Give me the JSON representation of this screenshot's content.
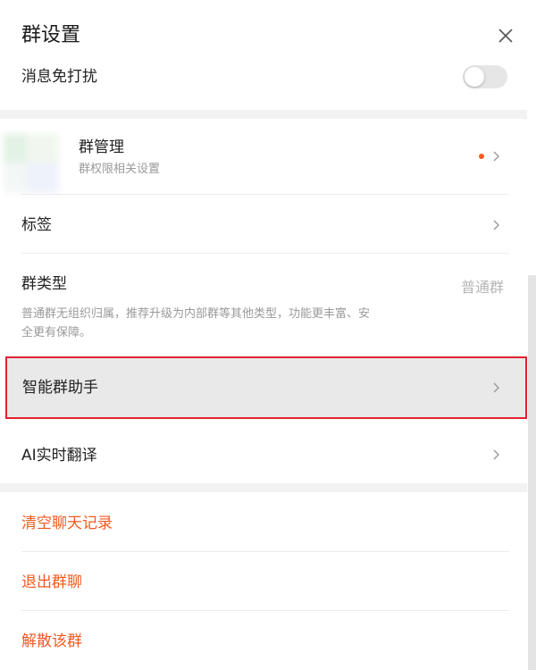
{
  "header": {
    "title": "群设置",
    "close_icon": "close-icon"
  },
  "settings": {
    "mute": {
      "label": "消息免打扰",
      "enabled": false
    },
    "group_manage": {
      "title": "群管理",
      "subtitle": "群权限相关设置",
      "has_badge": true
    },
    "tags": {
      "label": "标签"
    },
    "group_type": {
      "label": "群类型",
      "value": "普通群",
      "desc_line1": "普通群无组织归属，推荐升级为内部群等其他类型，功能更丰富、安",
      "desc_line2": "全更有保障。"
    },
    "smart_assistant": {
      "label": "智能群助手"
    },
    "ai_translate": {
      "label": "AI实时翻译"
    }
  },
  "danger_actions": {
    "clear_history": "清空聊天记录",
    "leave_group": "退出群聊",
    "dissolve_group": "解散该群"
  },
  "colors": {
    "danger": "#f25a22",
    "highlight_border": "#e0232e",
    "badge_dot": "#f25a22"
  }
}
